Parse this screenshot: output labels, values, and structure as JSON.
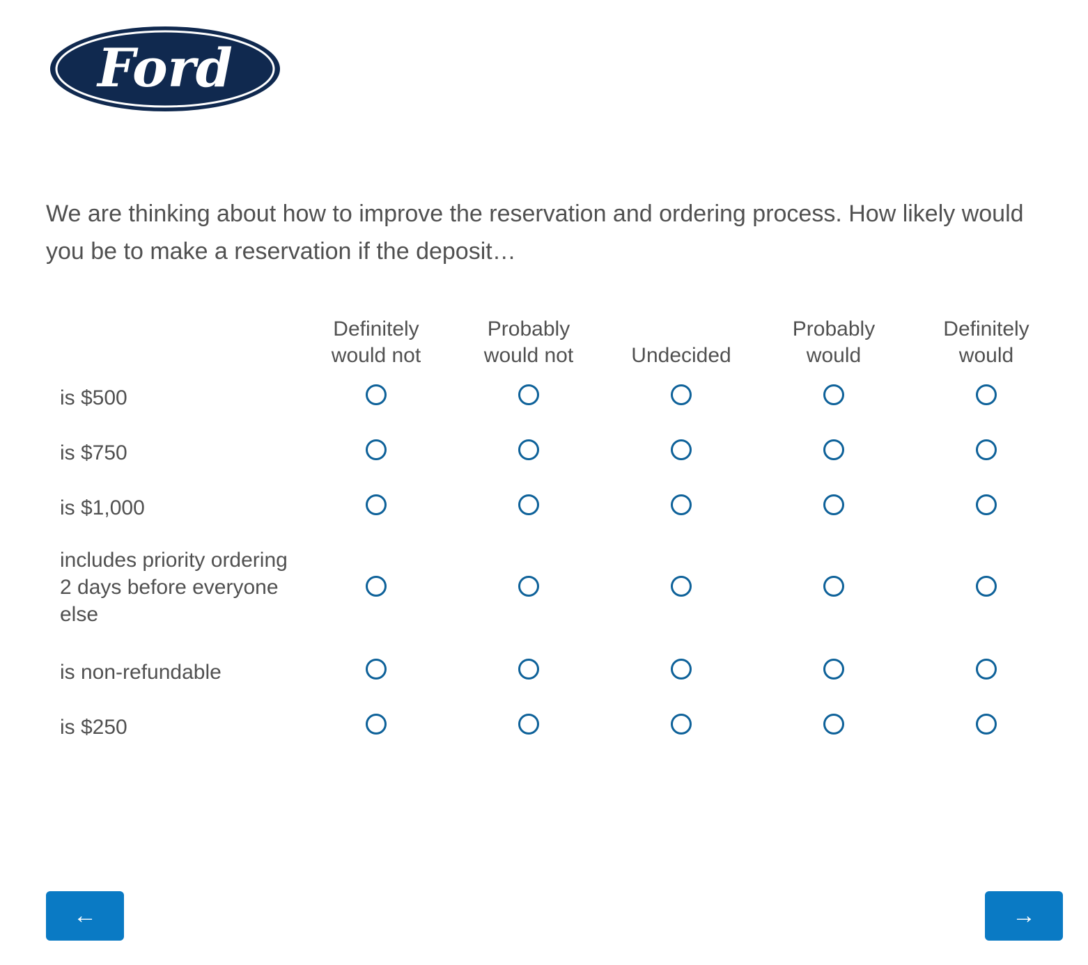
{
  "brand": {
    "logo_text": "Ford",
    "logo_color": "#10294f",
    "accent_color": "#0a7ac4",
    "radio_color": "#0d6199"
  },
  "question": {
    "text": "We are thinking about how to improve the reservation and ordering process. How likely would you be to make a reservation if the deposit…"
  },
  "scale": [
    {
      "line1": "Definitely",
      "line2": "would not"
    },
    {
      "line1": "Probably",
      "line2": "would not"
    },
    {
      "line1": "",
      "line2": "Undecided"
    },
    {
      "line1": "Probably",
      "line2": "would"
    },
    {
      "line1": "Definitely",
      "line2": "would"
    }
  ],
  "statements": [
    {
      "label": "is $500"
    },
    {
      "label": "is $750"
    },
    {
      "label": "is $1,000"
    },
    {
      "label": "includes priority ordering 2 days before everyone else"
    },
    {
      "label": "is non-refundable"
    },
    {
      "label": "is $250"
    }
  ],
  "nav": {
    "back_icon": "←",
    "next_icon": "→"
  }
}
